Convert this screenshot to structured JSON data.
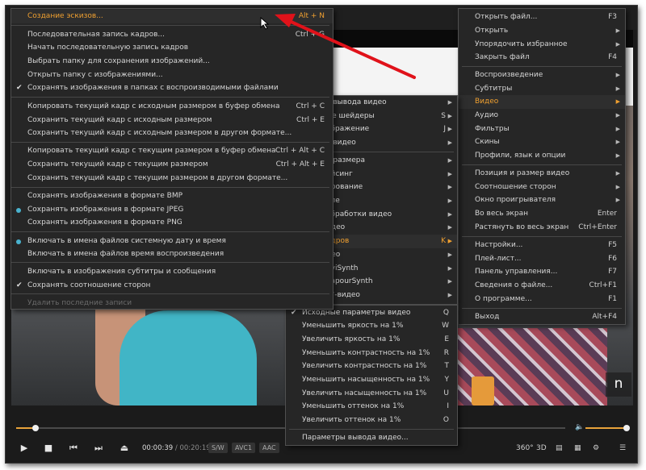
{
  "menu_right": {
    "items": [
      {
        "label": "Открыть файл...",
        "shortcut": "F3"
      },
      {
        "label": "Открыть",
        "arrow": "▶"
      },
      {
        "label": "Упорядочить избранное",
        "arrow": "▶"
      },
      {
        "label": "Закрыть файл",
        "shortcut": "F4"
      },
      {
        "label": "Воспроизведение",
        "arrow": "▶"
      },
      {
        "label": "Субтитры",
        "arrow": "▶"
      },
      {
        "label": "Видео",
        "arrow": "▶"
      },
      {
        "label": "Аудио",
        "arrow": "▶"
      },
      {
        "label": "Фильтры",
        "arrow": "▶"
      },
      {
        "label": "Скины",
        "arrow": "▶"
      },
      {
        "label": "Профили, язык и опции",
        "arrow": "▶"
      },
      {
        "label": "Позиция и размер видео",
        "arrow": "▶"
      },
      {
        "label": "Соотношение сторон",
        "arrow": "▶"
      },
      {
        "label": "Окно проигрывателя",
        "arrow": "▶"
      },
      {
        "label": "Во весь экран",
        "shortcut": "Enter"
      },
      {
        "label": "Растянуть во весь экран",
        "shortcut": "Ctrl+Enter"
      },
      {
        "label": "Настройки...",
        "shortcut": "F5"
      },
      {
        "label": "Плей-лист...",
        "shortcut": "F6"
      },
      {
        "label": "Панель управления...",
        "shortcut": "F7"
      },
      {
        "label": "Сведения о файле...",
        "shortcut": "Ctrl+F1"
      },
      {
        "label": "О программе...",
        "shortcut": "F1"
      },
      {
        "label": "Выход",
        "shortcut": "Alt+F4"
      }
    ]
  },
  "menu_video": {
    "items": [
      {
        "label": "о вывода видео",
        "arrow": "▶"
      },
      {
        "label": "ые шейдеры",
        "shortcut": "S",
        "arrow": "▶"
      },
      {
        "label": "ображение",
        "shortcut": "J",
        "arrow": "▶"
      },
      {
        "label": "а видео",
        "arrow": "▶"
      },
      {
        "label": "е размера",
        "arrow": "▶"
      },
      {
        "label": "ейсинг",
        "arrow": "▶"
      },
      {
        "label": "ирование",
        "arrow": "▶"
      },
      {
        "label": "оле",
        "arrow": "▶"
      },
      {
        "label": "обработки видео",
        "arrow": "▶"
      },
      {
        "label": "идео",
        "arrow": "▶"
      },
      {
        "label": "адров",
        "shortcut": "K",
        "arrow": "▶"
      },
      {
        "label": "део",
        "arrow": "▶"
      },
      {
        "label": "AviSynth",
        "arrow": "▶"
      },
      {
        "label": "VapourSynth",
        "arrow": "▶"
      },
      {
        "label": "0°-видео",
        "arrow": "▶"
      }
    ]
  },
  "menu_adjust": {
    "items": [
      {
        "label": "Исходные параметры видео",
        "shortcut": "Q",
        "checked": true
      },
      {
        "label": "Уменьшить яркость на 1%",
        "shortcut": "W"
      },
      {
        "label": "Увеличить яркость на 1%",
        "shortcut": "E"
      },
      {
        "label": "Уменьшить контрастность на 1%",
        "shortcut": "R"
      },
      {
        "label": "Увеличить контрастность на 1%",
        "shortcut": "T"
      },
      {
        "label": "Уменьшить насыщенность на 1%",
        "shortcut": "Y"
      },
      {
        "label": "Увеличить насыщенность на 1%",
        "shortcut": "U"
      },
      {
        "label": "Уменьшить оттенок на 1%",
        "shortcut": "I"
      },
      {
        "label": "Увеличить оттенок на 1%",
        "shortcut": "O"
      },
      {
        "label": "Параметры вывода видео..."
      }
    ]
  },
  "menu_frames": {
    "items": [
      {
        "label": "Создание эскизов...",
        "shortcut": "Alt + N"
      },
      {
        "label": "Последовательная запись кадров...",
        "shortcut": "Ctrl + G"
      },
      {
        "label": "Начать последовательную запись кадров"
      },
      {
        "label": "Выбрать папку для сохранения изображений..."
      },
      {
        "label": "Открыть папку с изображениями..."
      },
      {
        "label": "Сохранять изображения в папках с воспроизводимыми файлами",
        "mark": "check"
      },
      {
        "label": "Копировать текущий кадр с исходным размером в буфер обмена",
        "shortcut": "Ctrl + C"
      },
      {
        "label": "Сохранить текущий кадр с исходным размером",
        "shortcut": "Ctrl + E"
      },
      {
        "label": "Сохранить текущий кадр с исходным размером в другом формате..."
      },
      {
        "label": "Копировать текущий кадр с текущим размером в буфер обмена",
        "shortcut": "Ctrl + Alt + C"
      },
      {
        "label": "Сохранить текущий кадр с текущим размером",
        "shortcut": "Ctrl + Alt + E"
      },
      {
        "label": "Сохранить текущий кадр с текущим размером в другом формате..."
      },
      {
        "label": "Сохранять изображения в формате BMP"
      },
      {
        "label": "Сохранять изображения в формате JPEG",
        "mark": "dot"
      },
      {
        "label": "Сохранять изображения в формате PNG"
      },
      {
        "label": "Включать в имена файлов системную дату и время",
        "mark": "dot"
      },
      {
        "label": "Включать в имена файлов время воспроизведения"
      },
      {
        "label": "Включать в изображения субтитры и сообщения"
      },
      {
        "label": "Сохранять соотношение сторон",
        "mark": "check"
      },
      {
        "label": "Удалить последние записи",
        "disabled": true
      }
    ]
  },
  "player": {
    "time_current": "00:00:39",
    "time_sep": " / ",
    "time_total": "00:20:19",
    "badge_sw": "S/W",
    "badge_codec_v": "AVC1",
    "badge_codec_a": "AAC",
    "seek_progress": 0.035,
    "volume_level": 1.0,
    "icon_360": "360°",
    "icon_3d": "3D",
    "watermark": "n"
  },
  "colors": {
    "accent": "#f0a030",
    "radio": "#4ab3cf",
    "arrow": "#e0121a"
  }
}
